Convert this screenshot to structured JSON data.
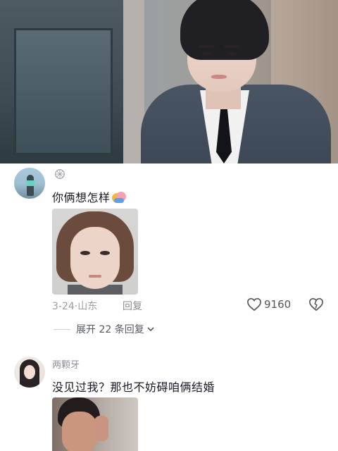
{
  "video": {
    "scene": "drama-still"
  },
  "comments": [
    {
      "username": "",
      "text": "你俩想怎样",
      "emoji": "couple-hug-emoji",
      "has_image": true,
      "date": "3-24",
      "location": "山东",
      "reply_label": "回复",
      "likes": "9160",
      "expand_label": "展开 22 条回复"
    },
    {
      "username": "两颗牙",
      "text": "没见过我？那也不妨碍咱俩结婚",
      "has_image": true
    }
  ],
  "meta_separator": "·",
  "colors": {
    "accent_text": "#161823",
    "muted": "#9c9ca2",
    "background": "#ffffff"
  }
}
